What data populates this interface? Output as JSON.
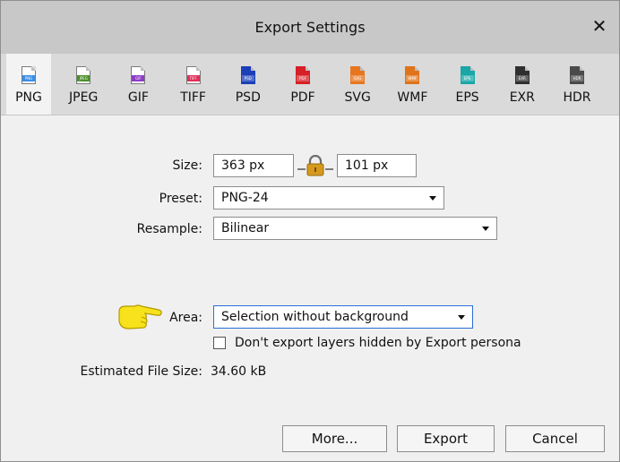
{
  "dialog": {
    "title": "Export Settings",
    "close_glyph": "✕"
  },
  "tabs": [
    {
      "label": "PNG",
      "badge": "PNG",
      "color": "#3a8ee6",
      "active": true
    },
    {
      "label": "JPEG",
      "badge": "JPEG",
      "color": "#4b8f2b",
      "active": false
    },
    {
      "label": "GIF",
      "badge": "GIF",
      "color": "#8e3cc6",
      "active": false
    },
    {
      "label": "TIFF",
      "badge": "TIFF",
      "color": "#e0305a",
      "active": false
    },
    {
      "label": "PSD",
      "badge": "PSD",
      "color": "#1b3fb8",
      "active": false
    },
    {
      "label": "PDF",
      "badge": "PDF",
      "color": "#d61f26",
      "active": false
    },
    {
      "label": "SVG",
      "badge": "SVG",
      "color": "#e8761f",
      "active": false
    },
    {
      "label": "WMF",
      "badge": "WMF",
      "color": "#e0731a",
      "active": false
    },
    {
      "label": "EPS",
      "badge": "EPS",
      "color": "#1aa6a6",
      "active": false
    },
    {
      "label": "EXR",
      "badge": "EXR",
      "color": "#2f2f2f",
      "active": false
    },
    {
      "label": "HDR",
      "badge": "HDR",
      "color": "#4a4a4a",
      "active": false
    }
  ],
  "form": {
    "size_label": "Size:",
    "width_value": "363 px",
    "height_value": "101 px",
    "preset_label": "Preset:",
    "preset_value": "PNG-24",
    "resample_label": "Resample:",
    "resample_value": "Bilinear",
    "area_label": "Area:",
    "area_value": "Selection without background",
    "hidden_layers_label": "Don't export layers hidden by Export persona",
    "hidden_layers_checked": false,
    "file_size_label": "Estimated File Size:",
    "file_size_value": "34.60 kB"
  },
  "buttons": {
    "more": "More...",
    "export": "Export",
    "cancel": "Cancel"
  },
  "icons": {
    "lock": "lock-icon",
    "pointer": "pointing-hand-icon"
  },
  "colors": {
    "titlebar": "#c8c8c8",
    "tabstrip": "#dadada",
    "focus": "#2a6fd6"
  }
}
